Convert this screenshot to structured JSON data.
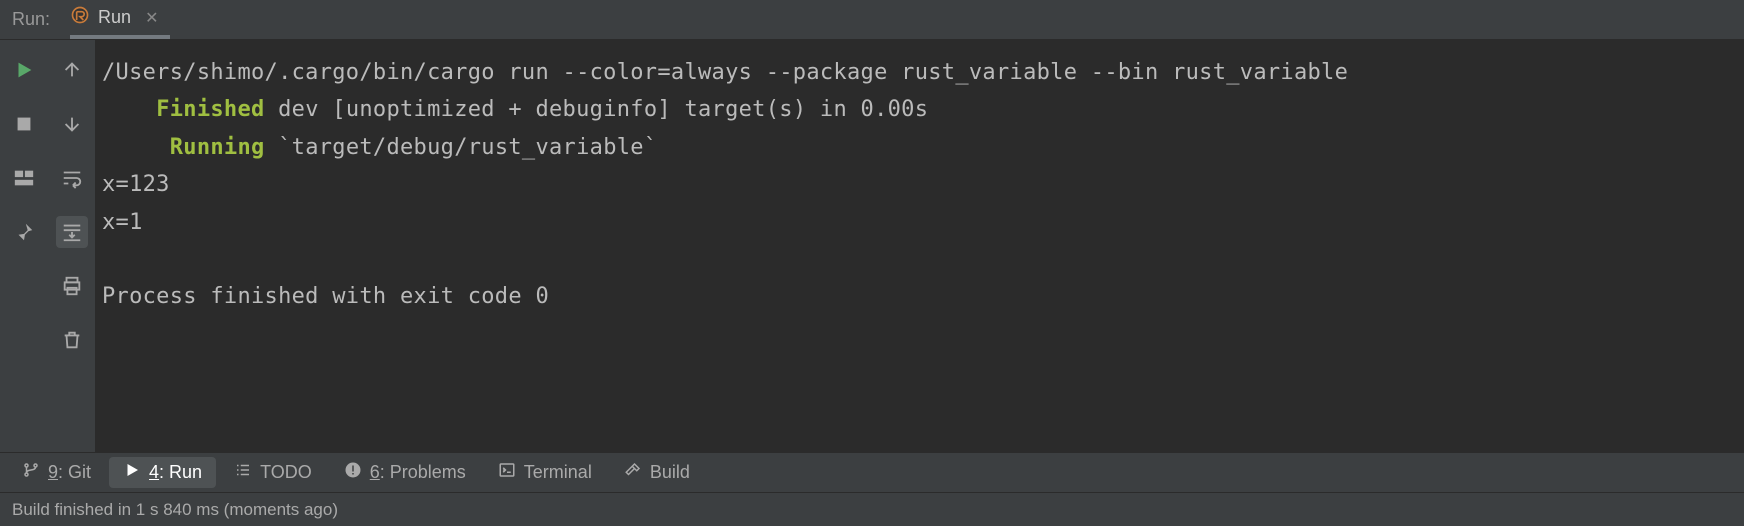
{
  "top": {
    "panel_label": "Run:",
    "tab_name": "Run",
    "tab_icon": "rust-icon"
  },
  "console": {
    "command": "/Users/shimo/.cargo/bin/cargo run --color=always --package rust_variable --bin rust_variable",
    "finished_kw": "Finished",
    "finished_rest": " dev [unoptimized + debuginfo] target(s) in 0.00s",
    "running_kw": "Running",
    "running_rest": " `target/debug/rust_variable`",
    "out_lines": [
      "x=123",
      "x=1"
    ],
    "exit_line": "Process finished with exit code 0"
  },
  "bottom_tabs": {
    "git": {
      "num": "9",
      "label": ": Git"
    },
    "run": {
      "num": "4",
      "label": ": Run"
    },
    "todo": {
      "label": "TODO"
    },
    "problems": {
      "num": "6",
      "label": ": Problems"
    },
    "terminal": {
      "label": "Terminal"
    },
    "build": {
      "label": "Build"
    }
  },
  "status": "Build finished in 1 s 840 ms (moments ago)"
}
